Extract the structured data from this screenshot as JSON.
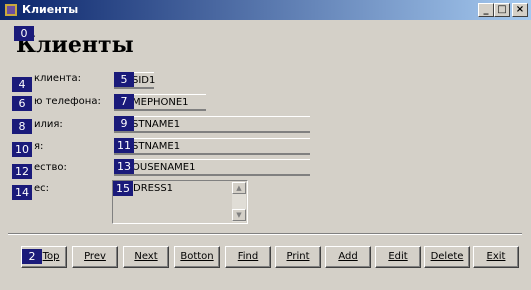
{
  "window": {
    "title": "Клиенты",
    "minimize": "_",
    "maximize": "□",
    "close": "×"
  },
  "form": {
    "heading": "Клиенты",
    "heading_tag": "0"
  },
  "fields": [
    {
      "tag": "4",
      "label": "клиента:",
      "tag2": "5",
      "value": "SID1"
    },
    {
      "tag": "6",
      "label": "ю телефона:",
      "tag2": "7",
      "value": "MEPHONE1"
    },
    {
      "tag": "8",
      "label": "илия:",
      "tag2": "9",
      "value": "STNAME1"
    },
    {
      "tag": "10",
      "label": "я:",
      "tag2": "11",
      "value": "STNAME1"
    },
    {
      "tag": "12",
      "label": "ество:",
      "tag2": "13",
      "value": "OUSENAME1"
    },
    {
      "tag": "14",
      "label": "ес:",
      "tag2": "15",
      "value": "DRESS1"
    }
  ],
  "buttons": [
    {
      "tag": "2",
      "label": "Top"
    },
    {
      "label": "Prev"
    },
    {
      "label": "Next"
    },
    {
      "label": "Botton"
    },
    {
      "label": "Find"
    },
    {
      "label": "Print"
    },
    {
      "label": "Add"
    },
    {
      "label": "Edit"
    },
    {
      "label": "Delete"
    },
    {
      "label": "Exit"
    }
  ],
  "colors": {
    "title_start": "#0a246a",
    "title_end": "#a6caf0",
    "tag_bg": "#1a1a7a",
    "window_bg": "#d4d0c8"
  }
}
